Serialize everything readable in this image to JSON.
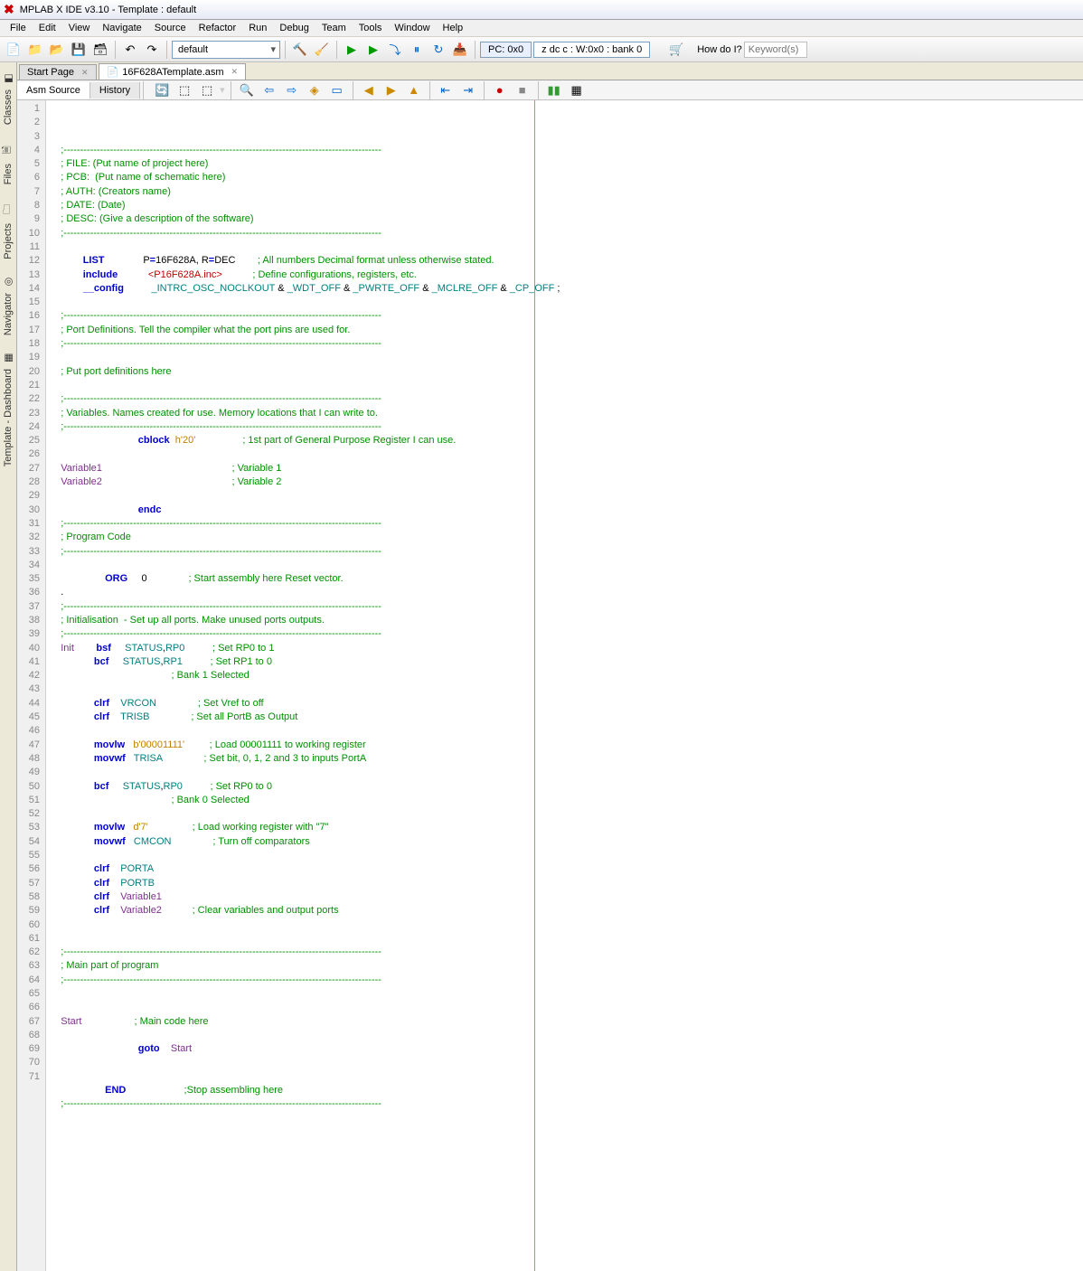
{
  "title": "MPLAB X IDE v3.10 - Template : default",
  "menus": [
    "File",
    "Edit",
    "View",
    "Navigate",
    "Source",
    "Refactor",
    "Run",
    "Debug",
    "Team",
    "Tools",
    "Window",
    "Help"
  ],
  "config": "default",
  "pc": "PC: 0x0",
  "status": "z dc c : W:0x0 : bank 0",
  "howdo": "How do I?",
  "search_ph": "Keyword(s)",
  "side": [
    {
      "label": "Classes",
      "icon": "◧"
    },
    {
      "label": "Files",
      "icon": "🗎"
    },
    {
      "label": "Projects",
      "icon": "🗀"
    },
    {
      "label": "Navigator",
      "icon": "◎"
    },
    {
      "label": "Template - Dashboard",
      "icon": "▦"
    }
  ],
  "tabs": [
    {
      "label": "Start Page",
      "active": false
    },
    {
      "label": "16F628ATemplate.asm",
      "active": true
    }
  ],
  "srctabs": [
    {
      "label": "Asm Source",
      "active": true
    },
    {
      "label": "History",
      "active": false
    }
  ],
  "code": [
    {
      "n": 1,
      "t": "    ;------------------------------------------------------------------------------------------------"
    },
    {
      "n": 2,
      "t": "    ; FILE: (Put name of project here)"
    },
    {
      "n": 3,
      "t": "    ; PCB:  (Put name of schematic here)"
    },
    {
      "n": 4,
      "t": "    ; AUTH: (Creators name)"
    },
    {
      "n": 5,
      "t": "    ; DATE: (Date)"
    },
    {
      "n": 6,
      "t": "    ; DESC: (Give a description of the software)"
    },
    {
      "n": 7,
      "t": "    ;------------------------------------------------------------------------------------------------"
    },
    {
      "n": 8,
      "t": ""
    },
    {
      "n": 9,
      "r": [
        {
          "c": "",
          "t": "            "
        },
        {
          "c": "kw",
          "t": "LIST"
        },
        {
          "c": "",
          "t": "              P"
        },
        {
          "c": "kw",
          "t": "="
        },
        {
          "c": "",
          "t": "16F628A, R"
        },
        {
          "c": "kw",
          "t": "="
        },
        {
          "c": "",
          "t": "DEC        "
        },
        {
          "c": "comment",
          "t": "; All numbers Decimal format unless otherwise stated."
        }
      ]
    },
    {
      "n": 10,
      "r": [
        {
          "c": "",
          "t": "            "
        },
        {
          "c": "kw",
          "t": "include"
        },
        {
          "c": "",
          "t": "           "
        },
        {
          "c": "inc",
          "t": "<P16F628A.inc>"
        },
        {
          "c": "",
          "t": "           "
        },
        {
          "c": "comment",
          "t": "; Define configurations, registers, etc."
        }
      ]
    },
    {
      "n": 11,
      "r": [
        {
          "c": "",
          "t": "            "
        },
        {
          "c": "kw",
          "t": "__config"
        },
        {
          "c": "",
          "t": "          "
        },
        {
          "c": "id",
          "t": "_INTRC_OSC_NOCLKOUT"
        },
        {
          "c": "",
          "t": " & "
        },
        {
          "c": "id",
          "t": "_WDT_OFF"
        },
        {
          "c": "",
          "t": " & "
        },
        {
          "c": "id",
          "t": "_PWRTE_OFF"
        },
        {
          "c": "",
          "t": " & "
        },
        {
          "c": "id",
          "t": "_MCLRE_OFF"
        },
        {
          "c": "",
          "t": " & "
        },
        {
          "c": "id",
          "t": "_CP_OFF"
        },
        {
          "c": "",
          "t": " ;"
        }
      ]
    },
    {
      "n": 12,
      "t": ""
    },
    {
      "n": 13,
      "t": "    ;------------------------------------------------------------------------------------------------"
    },
    {
      "n": 14,
      "t": "    ; Port Definitions. Tell the compiler what the port pins are used for."
    },
    {
      "n": 15,
      "t": "    ;------------------------------------------------------------------------------------------------"
    },
    {
      "n": 16,
      "t": ""
    },
    {
      "n": 17,
      "t": "    ; Put port definitions here"
    },
    {
      "n": 18,
      "t": ""
    },
    {
      "n": 19,
      "t": "    ;------------------------------------------------------------------------------------------------"
    },
    {
      "n": 20,
      "t": "    ; Variables. Names created for use. Memory locations that I can write to."
    },
    {
      "n": 21,
      "t": "    ;------------------------------------------------------------------------------------------------"
    },
    {
      "n": 22,
      "r": [
        {
          "c": "",
          "t": "                                "
        },
        {
          "c": "kw",
          "t": "cblock"
        },
        {
          "c": "",
          "t": "  "
        },
        {
          "c": "str",
          "t": "h'20'"
        },
        {
          "c": "",
          "t": "                 "
        },
        {
          "c": "comment",
          "t": "; 1st part of General Purpose Register I can use."
        }
      ]
    },
    {
      "n": 23,
      "t": ""
    },
    {
      "n": 24,
      "r": [
        {
          "c": "",
          "t": "    "
        },
        {
          "c": "lbl",
          "t": "Variable1"
        },
        {
          "c": "",
          "t": "                                               "
        },
        {
          "c": "comment",
          "t": "; Variable 1"
        }
      ]
    },
    {
      "n": 25,
      "r": [
        {
          "c": "",
          "t": "    "
        },
        {
          "c": "lbl",
          "t": "Variable2"
        },
        {
          "c": "",
          "t": "                                               "
        },
        {
          "c": "comment",
          "t": "; Variable 2"
        }
      ]
    },
    {
      "n": 26,
      "t": ""
    },
    {
      "n": 27,
      "r": [
        {
          "c": "",
          "t": "                                "
        },
        {
          "c": "kw",
          "t": "endc"
        }
      ]
    },
    {
      "n": 28,
      "t": "    ;------------------------------------------------------------------------------------------------"
    },
    {
      "n": 29,
      "t": "    ; Program Code"
    },
    {
      "n": 30,
      "t": "    ;------------------------------------------------------------------------------------------------"
    },
    {
      "n": 31,
      "t": ""
    },
    {
      "n": 32,
      "r": [
        {
          "c": "",
          "t": "                    "
        },
        {
          "c": "kw",
          "t": "ORG"
        },
        {
          "c": "",
          "t": "     0               "
        },
        {
          "c": "comment",
          "t": "; Start assembly here Reset vector."
        }
      ]
    },
    {
      "n": 33,
      "r": [
        {
          "c": "",
          "t": "    ."
        }
      ]
    },
    {
      "n": 34,
      "t": "    ;------------------------------------------------------------------------------------------------"
    },
    {
      "n": 35,
      "t": "    ; Initialisation  - Set up all ports. Make unused ports outputs."
    },
    {
      "n": 36,
      "t": "    ;------------------------------------------------------------------------------------------------"
    },
    {
      "n": 37,
      "r": [
        {
          "c": "",
          "t": "    "
        },
        {
          "c": "lbl",
          "t": "Init"
        },
        {
          "c": "",
          "t": "        "
        },
        {
          "c": "kw",
          "t": "bsf"
        },
        {
          "c": "",
          "t": "     "
        },
        {
          "c": "id",
          "t": "STATUS"
        },
        {
          "c": "",
          "t": ","
        },
        {
          "c": "id",
          "t": "RP0"
        },
        {
          "c": "",
          "t": "          "
        },
        {
          "c": "comment",
          "t": "; Set RP0 to 1"
        }
      ]
    },
    {
      "n": 38,
      "r": [
        {
          "c": "",
          "t": "                "
        },
        {
          "c": "kw",
          "t": "bcf"
        },
        {
          "c": "",
          "t": "     "
        },
        {
          "c": "id",
          "t": "STATUS"
        },
        {
          "c": "",
          "t": ","
        },
        {
          "c": "id",
          "t": "RP1"
        },
        {
          "c": "",
          "t": "          "
        },
        {
          "c": "comment",
          "t": "; Set RP1 to 0"
        }
      ]
    },
    {
      "n": 39,
      "r": [
        {
          "c": "",
          "t": "                                            "
        },
        {
          "c": "comment",
          "t": "; Bank 1 Selected"
        }
      ]
    },
    {
      "n": 40,
      "t": ""
    },
    {
      "n": 41,
      "r": [
        {
          "c": "",
          "t": "                "
        },
        {
          "c": "kw",
          "t": "clrf"
        },
        {
          "c": "",
          "t": "    "
        },
        {
          "c": "id",
          "t": "VRCON"
        },
        {
          "c": "",
          "t": "               "
        },
        {
          "c": "comment",
          "t": "; Set Vref to off"
        }
      ]
    },
    {
      "n": 42,
      "r": [
        {
          "c": "",
          "t": "                "
        },
        {
          "c": "kw",
          "t": "clrf"
        },
        {
          "c": "",
          "t": "    "
        },
        {
          "c": "id",
          "t": "TRISB"
        },
        {
          "c": "",
          "t": "               "
        },
        {
          "c": "comment",
          "t": "; Set all PortB as Output"
        }
      ]
    },
    {
      "n": 43,
      "t": ""
    },
    {
      "n": 44,
      "r": [
        {
          "c": "",
          "t": "                "
        },
        {
          "c": "kw",
          "t": "movlw"
        },
        {
          "c": "",
          "t": "   "
        },
        {
          "c": "str",
          "t": "b'00001111'"
        },
        {
          "c": "",
          "t": "         "
        },
        {
          "c": "comment",
          "t": "; Load 00001111 to working register"
        }
      ]
    },
    {
      "n": 45,
      "r": [
        {
          "c": "",
          "t": "                "
        },
        {
          "c": "kw",
          "t": "movwf"
        },
        {
          "c": "",
          "t": "   "
        },
        {
          "c": "id",
          "t": "TRISA"
        },
        {
          "c": "",
          "t": "               "
        },
        {
          "c": "comment",
          "t": "; Set bit, 0, 1, 2 and 3 to inputs PortA"
        }
      ]
    },
    {
      "n": 46,
      "t": ""
    },
    {
      "n": 47,
      "r": [
        {
          "c": "",
          "t": "                "
        },
        {
          "c": "kw",
          "t": "bcf"
        },
        {
          "c": "",
          "t": "     "
        },
        {
          "c": "id",
          "t": "STATUS"
        },
        {
          "c": "",
          "t": ","
        },
        {
          "c": "id",
          "t": "RP0"
        },
        {
          "c": "",
          "t": "          "
        },
        {
          "c": "comment",
          "t": "; Set RP0 to 0"
        }
      ]
    },
    {
      "n": 48,
      "r": [
        {
          "c": "",
          "t": "                                            "
        },
        {
          "c": "comment",
          "t": "; Bank 0 Selected"
        }
      ]
    },
    {
      "n": 49,
      "t": ""
    },
    {
      "n": 50,
      "r": [
        {
          "c": "",
          "t": "                "
        },
        {
          "c": "kw",
          "t": "movlw"
        },
        {
          "c": "",
          "t": "   "
        },
        {
          "c": "str",
          "t": "d'7'"
        },
        {
          "c": "",
          "t": "                "
        },
        {
          "c": "comment",
          "t": "; Load working register with \"7\""
        }
      ]
    },
    {
      "n": 51,
      "r": [
        {
          "c": "",
          "t": "                "
        },
        {
          "c": "kw",
          "t": "movwf"
        },
        {
          "c": "",
          "t": "   "
        },
        {
          "c": "id",
          "t": "CMCON"
        },
        {
          "c": "",
          "t": "               "
        },
        {
          "c": "comment",
          "t": "; Turn off comparators"
        }
      ]
    },
    {
      "n": 52,
      "t": ""
    },
    {
      "n": 53,
      "r": [
        {
          "c": "",
          "t": "                "
        },
        {
          "c": "kw",
          "t": "clrf"
        },
        {
          "c": "",
          "t": "    "
        },
        {
          "c": "id",
          "t": "PORTA"
        }
      ]
    },
    {
      "n": 54,
      "r": [
        {
          "c": "",
          "t": "                "
        },
        {
          "c": "kw",
          "t": "clrf"
        },
        {
          "c": "",
          "t": "    "
        },
        {
          "c": "id",
          "t": "PORTB"
        }
      ]
    },
    {
      "n": 55,
      "r": [
        {
          "c": "",
          "t": "                "
        },
        {
          "c": "kw",
          "t": "clrf"
        },
        {
          "c": "",
          "t": "    "
        },
        {
          "c": "lbl",
          "t": "Variable1"
        }
      ]
    },
    {
      "n": 56,
      "r": [
        {
          "c": "",
          "t": "                "
        },
        {
          "c": "kw",
          "t": "clrf"
        },
        {
          "c": "",
          "t": "    "
        },
        {
          "c": "lbl",
          "t": "Variable2"
        },
        {
          "c": "",
          "t": "           "
        },
        {
          "c": "comment",
          "t": "; Clear variables and output ports"
        }
      ]
    },
    {
      "n": 57,
      "t": ""
    },
    {
      "n": 58,
      "t": ""
    },
    {
      "n": 59,
      "t": "    ;------------------------------------------------------------------------------------------------"
    },
    {
      "n": 60,
      "t": "    ; Main part of program"
    },
    {
      "n": 61,
      "t": "    ;------------------------------------------------------------------------------------------------"
    },
    {
      "n": 62,
      "t": ""
    },
    {
      "n": 63,
      "t": ""
    },
    {
      "n": 64,
      "r": [
        {
          "c": "",
          "t": "    "
        },
        {
          "c": "lbl",
          "t": "Start"
        },
        {
          "c": "",
          "t": "                   "
        },
        {
          "c": "comment",
          "t": "; Main code here"
        }
      ]
    },
    {
      "n": 65,
      "t": ""
    },
    {
      "n": 66,
      "r": [
        {
          "c": "",
          "t": "                                "
        },
        {
          "c": "kw",
          "t": "goto"
        },
        {
          "c": "",
          "t": "    "
        },
        {
          "c": "lbl",
          "t": "Start"
        }
      ]
    },
    {
      "n": 67,
      "t": ""
    },
    {
      "n": 68,
      "t": ""
    },
    {
      "n": 69,
      "r": [
        {
          "c": "",
          "t": "                    "
        },
        {
          "c": "kw",
          "t": "END"
        },
        {
          "c": "",
          "t": "                     "
        },
        {
          "c": "comment",
          "t": ";Stop assembling here"
        }
      ]
    },
    {
      "n": 70,
      "t": "    ;------------------------------------------------------------------------------------------------"
    },
    {
      "n": 71,
      "t": ""
    }
  ]
}
